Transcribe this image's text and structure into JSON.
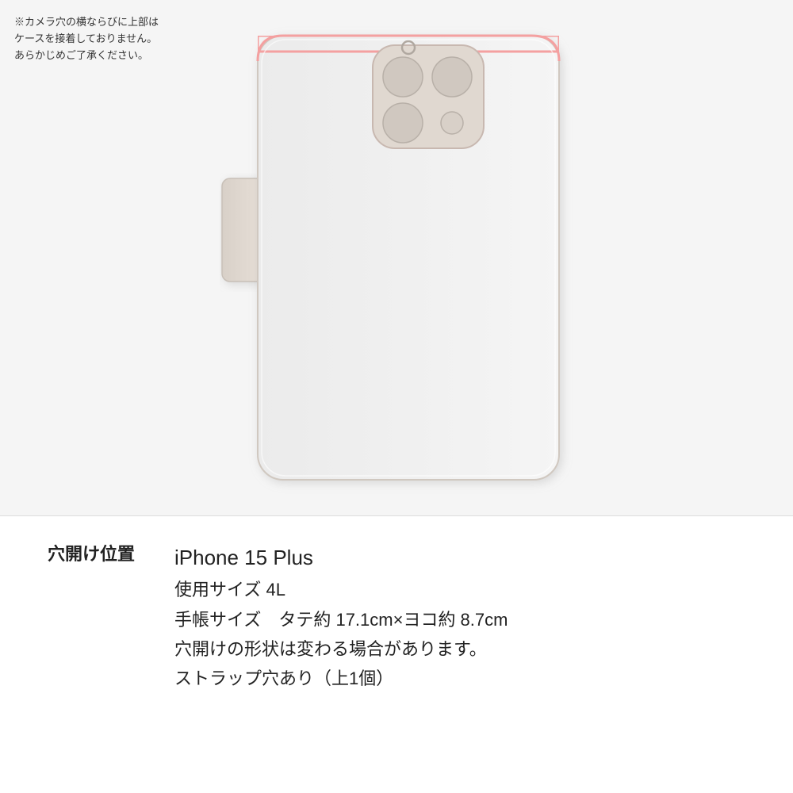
{
  "camera_note": {
    "line1": "※カメラ穴の横ならびに上部は",
    "line2": "ケースを接着しておりません。",
    "line3": "あらかじめご了承ください。"
  },
  "info": {
    "label": "穴開け位置",
    "device": "iPhone 15 Plus",
    "size_label": "使用サイズ 4L",
    "dimensions": "手帳サイズ　タテ約 17.1cm×ヨコ約 8.7cm",
    "hole_note": "穴開けの形状は変わる場合があります。",
    "strap": "ストラップ穴あり（上1個）"
  },
  "colors": {
    "case_bg": "#f0f0f0",
    "case_border": "#d0c8c0",
    "case_shadow": "#c8c0b8",
    "spine_color": "#e8e0d8",
    "camera_cutout_bg": "#e8e0d8",
    "camera_cutout_border": "#c8b8b0",
    "hole_color": "#d0c8c0",
    "accent_pink": "#f4a0a0"
  }
}
